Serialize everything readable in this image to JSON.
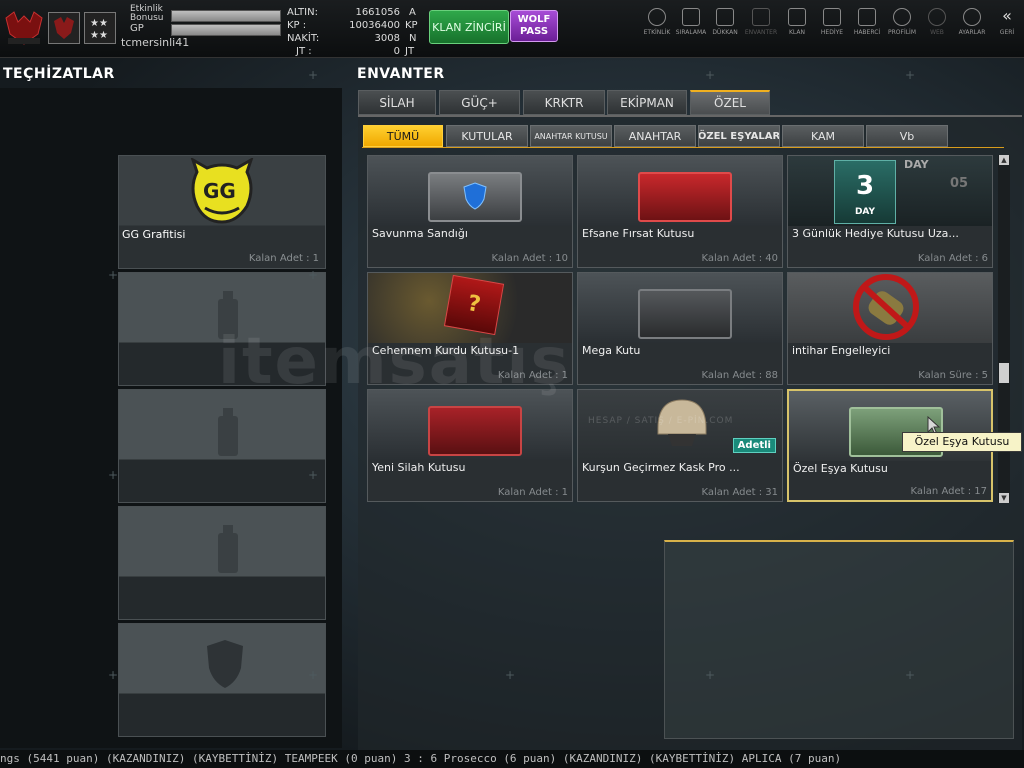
{
  "player": {
    "event_bonus_label": "Etkinlik Bonusu",
    "gp_label": "GP",
    "username": "tcmersinli41"
  },
  "currencies": [
    {
      "label": "ALTIN:",
      "value": "1661056",
      "unit": "A"
    },
    {
      "label": "KP :",
      "value": "10036400",
      "unit": "KP"
    },
    {
      "label": "NAKİT:",
      "value": "3008",
      "unit": "N"
    },
    {
      "label": "JT :",
      "value": "0",
      "unit": "JT"
    }
  ],
  "buttons": {
    "klan_zinciri": "KLAN ZİNCİRİ",
    "wolf_pass": "WOLF PASS"
  },
  "nav": [
    {
      "label": "ETKİNLİK",
      "icon": "timer-icon"
    },
    {
      "label": "SIRALAMA",
      "icon": "ranking-icon"
    },
    {
      "label": "DÜKKAN",
      "icon": "cart-icon"
    },
    {
      "label": "ENVANTER",
      "icon": "inventory-icon"
    },
    {
      "label": "KLAN",
      "icon": "shield-icon"
    },
    {
      "label": "HEDİYE",
      "icon": "gift-icon"
    },
    {
      "label": "HABERCİ",
      "icon": "megaphone-icon"
    },
    {
      "label": "PROFİLİM",
      "icon": "profile-icon"
    },
    {
      "label": "WEB",
      "icon": "globe-icon"
    },
    {
      "label": "AYARLAR",
      "icon": "gear-icon"
    },
    {
      "label": "GERİ",
      "icon": "back-icon"
    }
  ],
  "equipment": {
    "title": "TEÇHİZATLAR",
    "slots": [
      {
        "name": "GG Grafitisi",
        "quantity": "Kalan Adet : 1",
        "icon": "gg-graffiti-icon"
      },
      {
        "name": "",
        "quantity": "",
        "icon": "spray-can-icon"
      },
      {
        "name": "",
        "quantity": "",
        "icon": "spray-can-icon"
      },
      {
        "name": "",
        "quantity": "",
        "icon": "spray-can-icon"
      },
      {
        "name": "",
        "quantity": "",
        "icon": "shield-icon"
      }
    ]
  },
  "inventory": {
    "title": "ENVANTER",
    "tabs": [
      "SİLAH",
      "GÜÇ+",
      "KRKTR",
      "EKİPMAN",
      "ÖZEL"
    ],
    "active_tab": "ÖZEL",
    "subtabs": [
      "TÜMÜ",
      "KUTULAR",
      "ANAHTAR KUTUSU",
      "ANAHTAR",
      "ÖZEL EŞYALAR",
      "KAM",
      "Vb"
    ],
    "active_subtab": "TÜMÜ",
    "items": [
      {
        "name": "Savunma Sandığı",
        "quantity": "Kalan Adet : 10"
      },
      {
        "name": "Efsane Fırsat Kutusu",
        "quantity": "Kalan Adet : 40"
      },
      {
        "name": "3 Günlük Hediye Kutusu Uza...",
        "quantity": "Kalan Adet : 6",
        "day_number": "3",
        "day_label": "DAY",
        "day_top": "DAY",
        "day_side": "05"
      },
      {
        "name": "Cehennem Kurdu Kutusu-1",
        "quantity": "Kalan Adet : 1"
      },
      {
        "name": "Mega Kutu",
        "quantity": "Kalan Adet : 88"
      },
      {
        "name": "intihar Engelleyici",
        "quantity": "Kalan Süre : 5"
      },
      {
        "name": "Yeni Silah Kutusu",
        "quantity": "Kalan Adet : 1"
      },
      {
        "name": "Kurşun Geçirmez Kask Pro ...",
        "quantity": "Kalan Adet : 31",
        "badge": "Adetli"
      },
      {
        "name": "Özel Eşya Kutusu",
        "quantity": "Kalan Adet : 17"
      }
    ],
    "tooltip": "Özel Eşya Kutusu"
  },
  "watermark": {
    "text": "itemsatış",
    "sub": "HESAP / SATIŞ / E-PİN.COM"
  },
  "ticker": "ngs (5441 puan) (KAZANDINIZ)        (KAYBETTİNİZ) TEAMPEEK (0 puan) 3 : 6 Prosecco (6 puan) (KAZANDINIZ)               (KAYBETTİNİZ) APLICA (7 puan)",
  "colors": {
    "accent": "#f0a800",
    "klan": "#2fa84a",
    "wolf": "#a74cd6",
    "selected_border": "#d7c36a"
  }
}
